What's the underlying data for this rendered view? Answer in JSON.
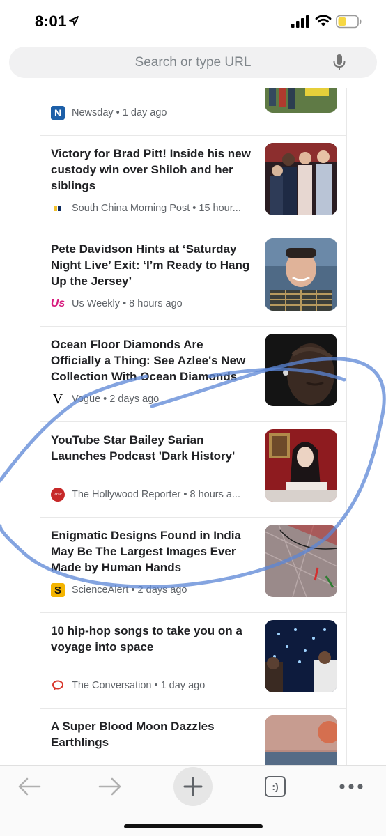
{
  "status_bar": {
    "time": "8:01"
  },
  "search": {
    "placeholder": "Search or type URL"
  },
  "feed": {
    "partial_card": {
      "source": "Newsday",
      "age": "1 day ago"
    },
    "cards": [
      {
        "title": "Victory for Brad Pitt! Inside his new custody win over Shiloh and her siblings",
        "source_line": "South China Morning Post • 15 hour...",
        "logo": "scmp-logo"
      },
      {
        "title": "Pete Davidson Hints at ‘Saturday Night Live’ Exit: ‘I’m Ready to Hang Up the Jersey’",
        "source_line": "Us Weekly • 8 hours ago",
        "logo": "us-weekly-logo",
        "logo_text": "Us"
      },
      {
        "title": "Ocean Floor Diamonds Are Officially a Thing: See Azlee's New Collection With Ocean Diamonds",
        "source_line": "Vogue • 2 days ago",
        "logo": "vogue-logo",
        "logo_text": "V"
      },
      {
        "title": "YouTube Star Bailey Sarian Launches Podcast 'Dark History'",
        "source_line": "The Hollywood Reporter • 8 hours a...",
        "logo": "thr-logo",
        "logo_text": "THR"
      },
      {
        "title": "Enigmatic Designs Found in India May Be The Largest Images Ever Made by Human Hands",
        "source_line": "ScienceAlert • 2 days ago",
        "logo": "sciencealert-logo",
        "logo_text": "S"
      },
      {
        "title": "10 hip-hop songs to take you on a voyage into space",
        "source_line": "The Conversation • 1 day ago",
        "logo": "the-conversation-logo"
      },
      {
        "title": "A Super Blood Moon Dazzles Earthlings"
      }
    ]
  },
  "toolbar": {
    "tab_icon_text": ":)"
  },
  "colors": {
    "accent_blue": "#1a73e8",
    "annotation_blue": "#5b86d6",
    "battery_yellow": "#f6d743"
  }
}
